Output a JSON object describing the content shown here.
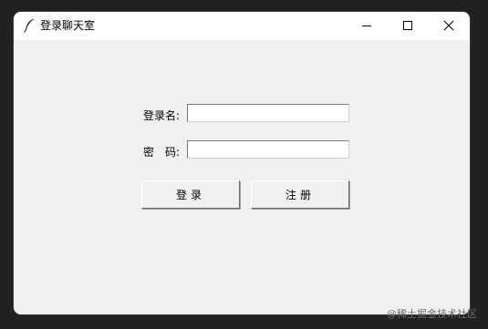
{
  "window": {
    "title": "登录聊天室",
    "icon": "feather-icon",
    "controls": {
      "minimize_icon": "minimize-icon",
      "maximize_icon": "maximize-icon",
      "close_icon": "close-icon"
    }
  },
  "form": {
    "username_label": "登录名:",
    "username_value": "",
    "password_label": "密　码:",
    "password_value": "",
    "login_button": "登录",
    "register_button": "注册"
  },
  "watermark": "@稀土掘金技术社区"
}
